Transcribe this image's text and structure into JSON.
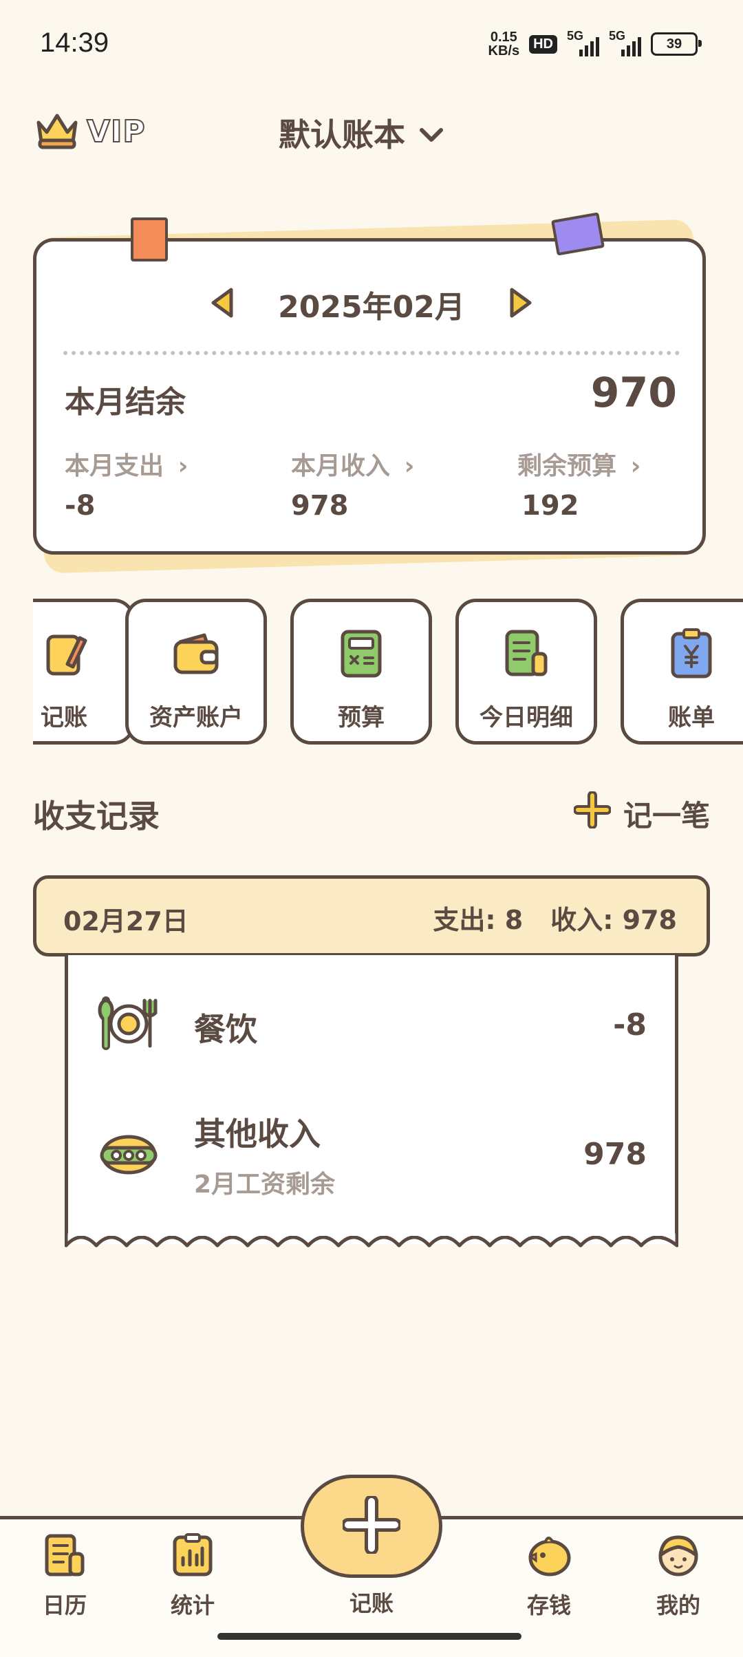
{
  "status_bar": {
    "time": "14:39",
    "net_speed_value": "0.15",
    "net_speed_unit": "KB/s",
    "hd_label": "HD",
    "signal1_label": "5G",
    "signal2_label": "5G",
    "battery_level": "39"
  },
  "header": {
    "vip_label": "VIP",
    "book_name": "默认账本"
  },
  "summary": {
    "month": "2025年02月",
    "balance_label": "本月结余",
    "balance_value": "970",
    "expense_label": "本月支出",
    "expense_value": "-8",
    "income_label": "本月收入",
    "income_value": "978",
    "budget_label": "剩余预算",
    "budget_value": "192"
  },
  "quick_actions": [
    {
      "label": "记账",
      "icon": "pencil-note-icon"
    },
    {
      "label": "资产账户",
      "icon": "wallet-icon"
    },
    {
      "label": "预算",
      "icon": "calculator-icon"
    },
    {
      "label": "今日明细",
      "icon": "receipt-icon"
    },
    {
      "label": "账单",
      "icon": "bill-icon"
    }
  ],
  "records": {
    "title": "收支记录",
    "add_label": "记一笔",
    "day": {
      "date": "02月27日",
      "expense_text": "支出: 8",
      "income_text": "收入: 978"
    },
    "items": [
      {
        "category": "餐饮",
        "note": "",
        "amount": "-8",
        "icon": "dining-plate-icon"
      },
      {
        "category": "其他收入",
        "note": "2月工资剩余",
        "amount": "978",
        "icon": "other-income-icon"
      }
    ]
  },
  "bottom_nav": {
    "calendar": "日历",
    "stats": "统计",
    "record": "记账",
    "savings": "存钱",
    "mine": "我的"
  },
  "colors": {
    "background": "#FDF8EE",
    "outline": "#5A4A42",
    "accent_yellow": "#FCD98A",
    "muted_text": "#A69A93"
  }
}
